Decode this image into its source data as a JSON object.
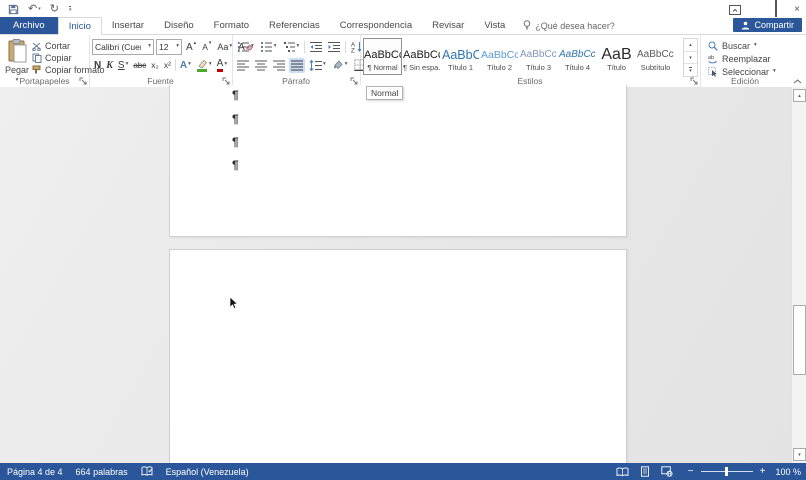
{
  "icons": {
    "dropdown": "▾",
    "up": "▴",
    "pilcrow": "¶",
    "close": "×",
    "undo": "↶",
    "redo": "↻",
    "grow_a": "A",
    "shrink_a": "A",
    "change_case": "Aa",
    "clear_a": "A",
    "effects_a": "A",
    "color_a": "A",
    "bold": "N",
    "italic": "K",
    "underline": "S",
    "strike": "abc",
    "subscript": "x₂",
    "superscript": "x²"
  },
  "titlebar": {
    "share_label": "Compartir"
  },
  "tabs": {
    "file": "Archivo",
    "items": [
      "Inicio",
      "Insertar",
      "Diseño",
      "Formato",
      "Referencias",
      "Correspondencia",
      "Revisar",
      "Vista"
    ],
    "tell_me": "¿Qué desea hacer?"
  },
  "ribbon": {
    "clipboard": {
      "label": "Portapapeles",
      "paste": "Pegar",
      "cut": "Cortar",
      "copy": "Copiar",
      "format_painter": "Copiar formato"
    },
    "font": {
      "label": "Fuente",
      "name_value": "Calibri (Cuerpo",
      "size_value": "12"
    },
    "paragraph": {
      "label": "Párrafo"
    },
    "styles": {
      "label": "Estilos",
      "items": [
        {
          "sample": "AaBbCcD",
          "name": "¶ Normal"
        },
        {
          "sample": "AaBbCcD",
          "name": "¶ Sin espa..."
        },
        {
          "sample": "AaBbCc",
          "name": "Título 1"
        },
        {
          "sample": "AaBbCcD",
          "name": "Título 2"
        },
        {
          "sample": "AaBbCcD",
          "name": "Título 3"
        },
        {
          "sample": "AaBbCcD",
          "name": "Título 4"
        },
        {
          "sample": "AaB",
          "name": "Título"
        },
        {
          "sample": "AaBbCcD",
          "name": "Subtítulo"
        }
      ]
    },
    "editing": {
      "label": "Edición",
      "find": "Buscar",
      "replace": "Reemplazar",
      "select": "Seleccionar"
    }
  },
  "document": {
    "tooltip": "Normal",
    "pilcrow": "¶"
  },
  "statusbar": {
    "page": "Página 4 de 4",
    "words": "664 palabras",
    "language": "Español (Venezuela)",
    "zoom_out": "−",
    "zoom_in": "+",
    "zoom_level": "100 %"
  }
}
